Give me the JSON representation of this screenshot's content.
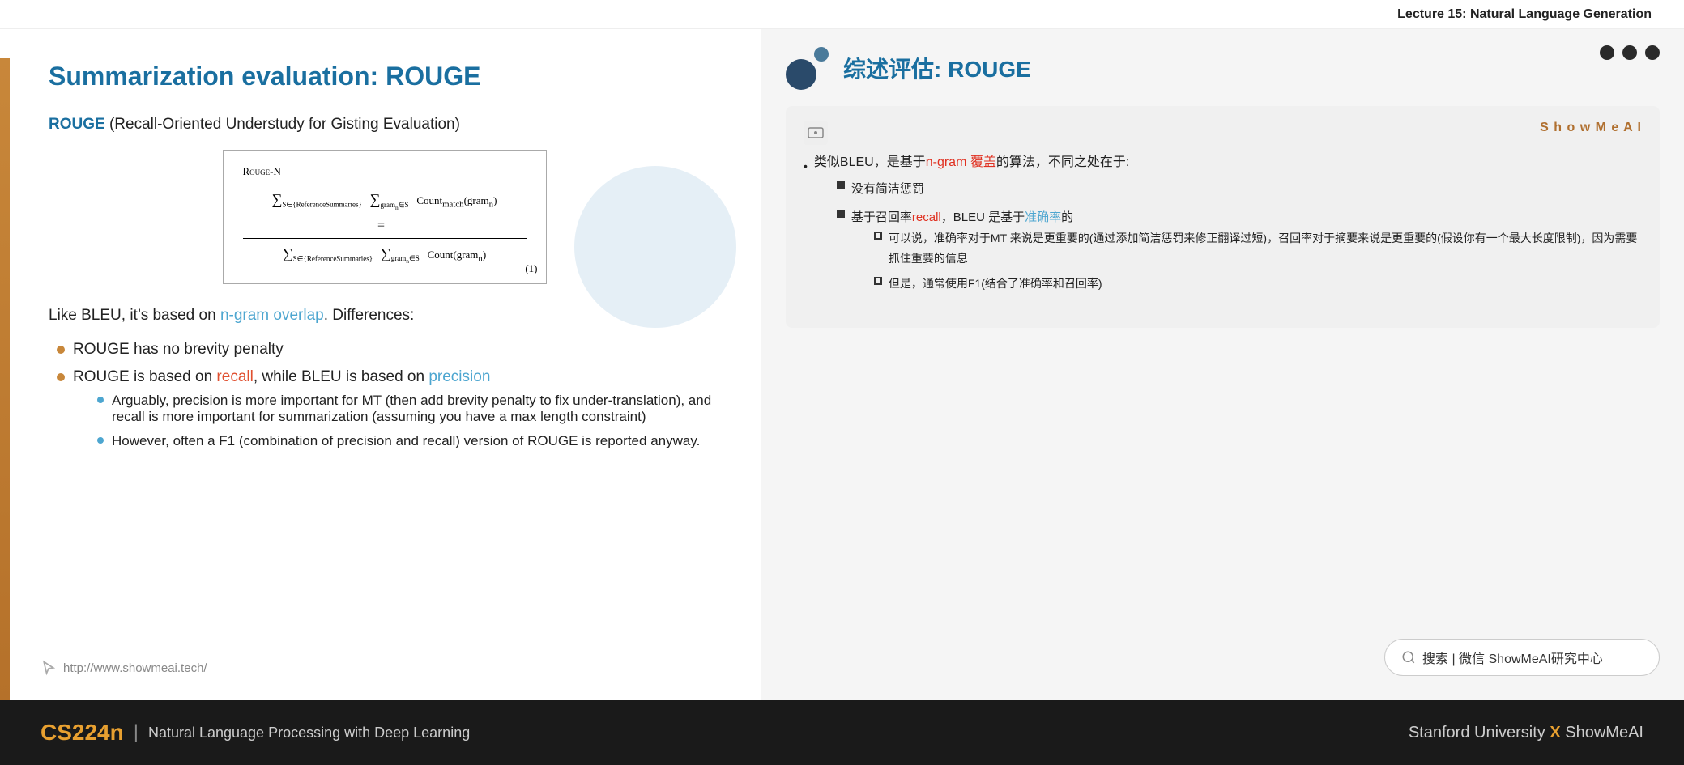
{
  "header": {
    "lecture_title": "Lecture 15: Natural Language Generation"
  },
  "left_panel": {
    "title": "Summarization evaluation: ROUGE",
    "intro_pre": "",
    "rouge_link_text": "ROUGE",
    "intro_text": " (Recall-Oriented Understudy for Gisting Evaluation)",
    "formula_label": "Rouge-N",
    "formula_number": "(1)",
    "bleu_text_pre": "Like BLEU, it’s based on ",
    "ngram_overlap": "n-gram overlap",
    "bleu_text_post": ". Differences:",
    "bullets": [
      {
        "text": "ROUGE has no brevity penalty"
      },
      {
        "text_pre": "ROUGE is based on ",
        "recall": "recall",
        "text_mid": ", while BLEU is based on ",
        "precision": "precision",
        "sub": [
          "Arguably, precision is more important for MT (then add brevity penalty to fix under-translation), and recall is more important for summarization (assuming you have a max length constraint)",
          "However, often a F1 (combination of precision and recall) version of ROUGE is reported anyway."
        ]
      }
    ],
    "url": "http://www.showmeai.tech/"
  },
  "right_panel": {
    "title": "综述评估: ROUGE",
    "dots": [
      "filled",
      "filled",
      "filled"
    ],
    "showmeai_brand": "S h o w M e A I",
    "card": {
      "content_line1_pre": "类似BLEU，是基于",
      "content_line1_ngram": "n-gram 覆盖",
      "content_line1_post": "的算法，不同之处在于:",
      "sub1_label": "没有简洁惩罚",
      "sub2_pre": "基于召回率",
      "sub2_recall": "recall",
      "sub2_mid": "，BLEU 是基于",
      "sub2_precision": "准确率",
      "sub2_post": "的",
      "sub2_sub1": "可以说，准确率对于MT  来说是更重要的(通过添加简洁惩罚来修正翻译过短)，召回率对于摘要来说是更重要的(假设你有一个最大长度限制)，因为需要抓住重要的信息",
      "sub2_sub2": "但是，通常使用F1(结合了准确率和召回率)"
    }
  },
  "search": {
    "placeholder": "搜索 | 微信 ShowMeAI研究中心"
  },
  "bottom": {
    "cs_label": "CS224n",
    "divider": "|",
    "subtitle": "Natural Language Processing with Deep Learning",
    "right_text": "Stanford University",
    "x_text": "X",
    "showmeai_text": "ShowMeAI"
  }
}
